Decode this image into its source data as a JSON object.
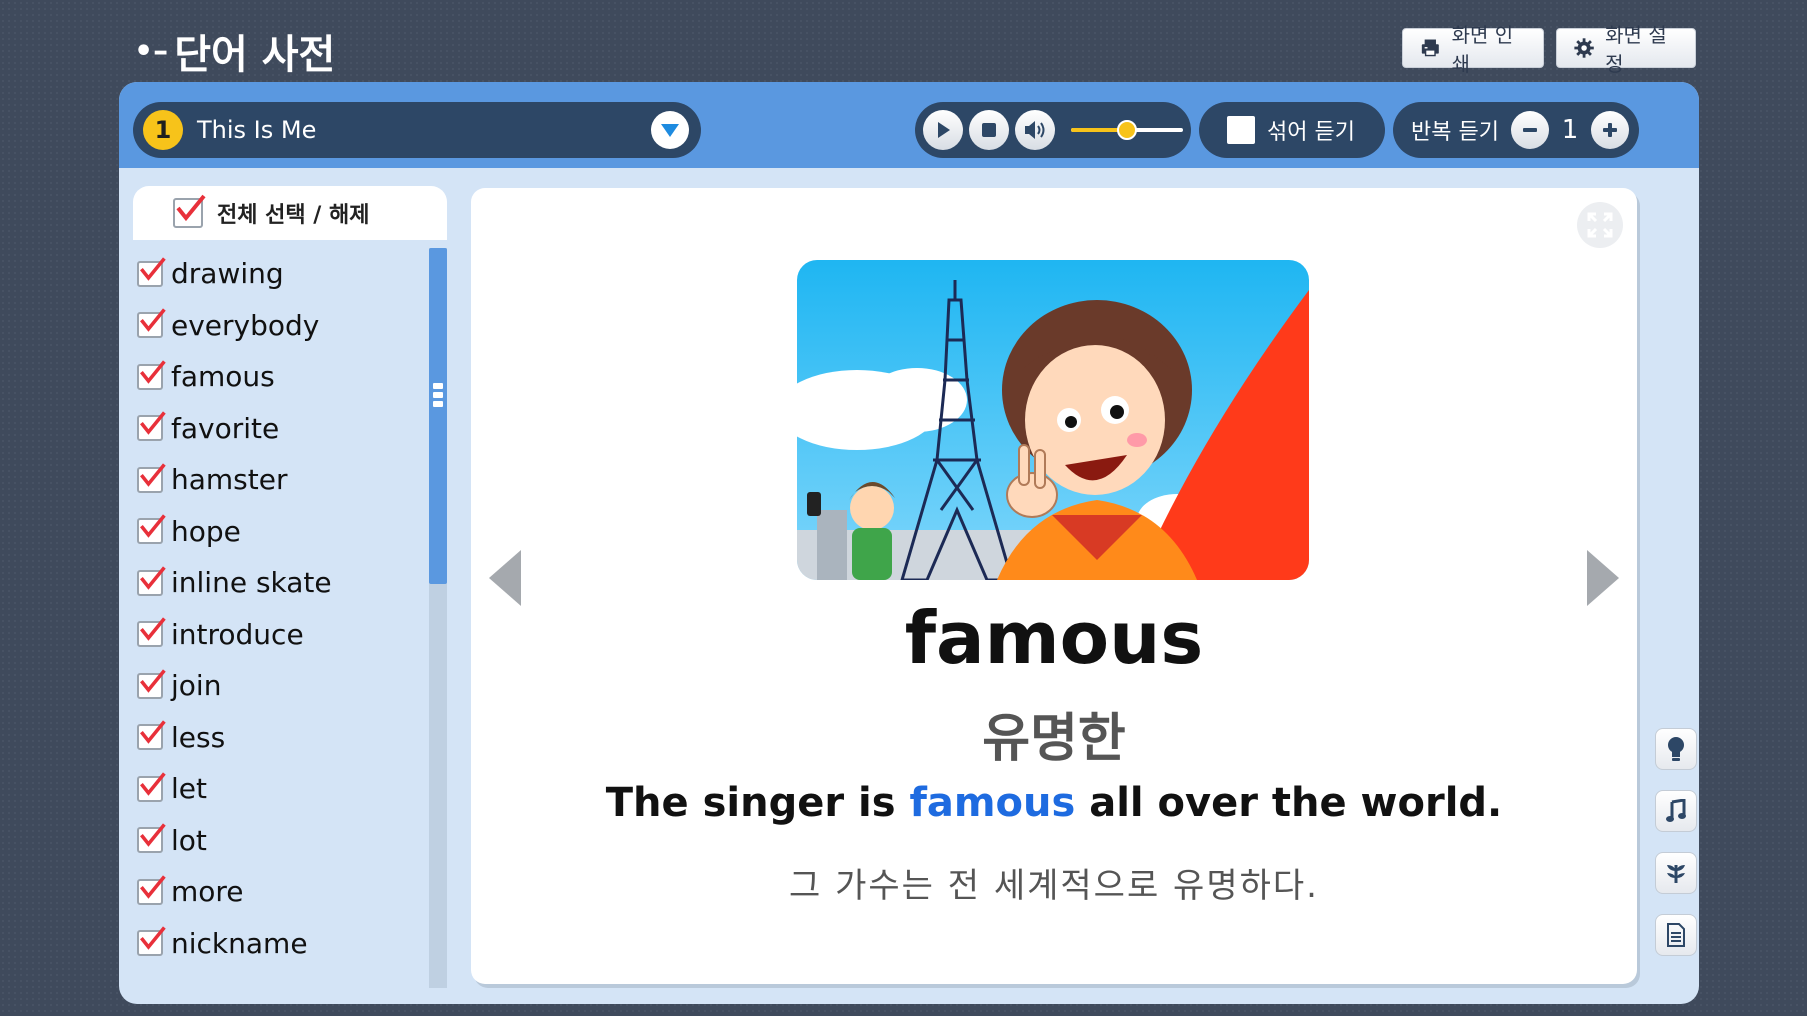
{
  "header": {
    "back_icon": "back-arrow-icon",
    "title": "단어 사전",
    "print_label": "화면 인쇄",
    "settings_label": "화면 설정"
  },
  "toolbar": {
    "unit_number": "1",
    "unit_title": "This Is Me",
    "volume_level": 0.5,
    "shuffle_label": "섞어 듣기",
    "shuffle_checked": false,
    "repeat_label": "반복 듣기",
    "repeat_count": "1"
  },
  "word_list": {
    "select_all_label": "전체 선택 / 해제",
    "select_all_checked": true,
    "items": [
      {
        "word": "drawing",
        "checked": true
      },
      {
        "word": "everybody",
        "checked": true
      },
      {
        "word": "famous",
        "checked": true
      },
      {
        "word": "favorite",
        "checked": true
      },
      {
        "word": "hamster",
        "checked": true
      },
      {
        "word": "hope",
        "checked": true
      },
      {
        "word": "inline skate",
        "checked": true
      },
      {
        "word": "introduce",
        "checked": true
      },
      {
        "word": "join",
        "checked": true
      },
      {
        "word": "less",
        "checked": true
      },
      {
        "word": "let",
        "checked": true
      },
      {
        "word": "lot",
        "checked": true
      },
      {
        "word": "more",
        "checked": true
      },
      {
        "word": "nickname",
        "checked": true
      }
    ]
  },
  "card": {
    "word": "famous",
    "meaning": "유명한",
    "sentence_before": "The singer is ",
    "sentence_highlight": "famous",
    "sentence_after": " all over the world.",
    "sentence_ko": "그 가수는 전 세계적으로 유명하다.",
    "illustration": "girl-selfie-eiffel-tower-illustration"
  },
  "colors": {
    "accent_blue": "#5a98e0",
    "dark_pill": "#2d4766",
    "highlight": "#1e6be0",
    "check_red": "#e8303a",
    "unit_badge": "#f7c31a"
  },
  "side_tools": [
    "lightbulb-icon",
    "music-note-icon",
    "plant-icon",
    "document-icon"
  ]
}
